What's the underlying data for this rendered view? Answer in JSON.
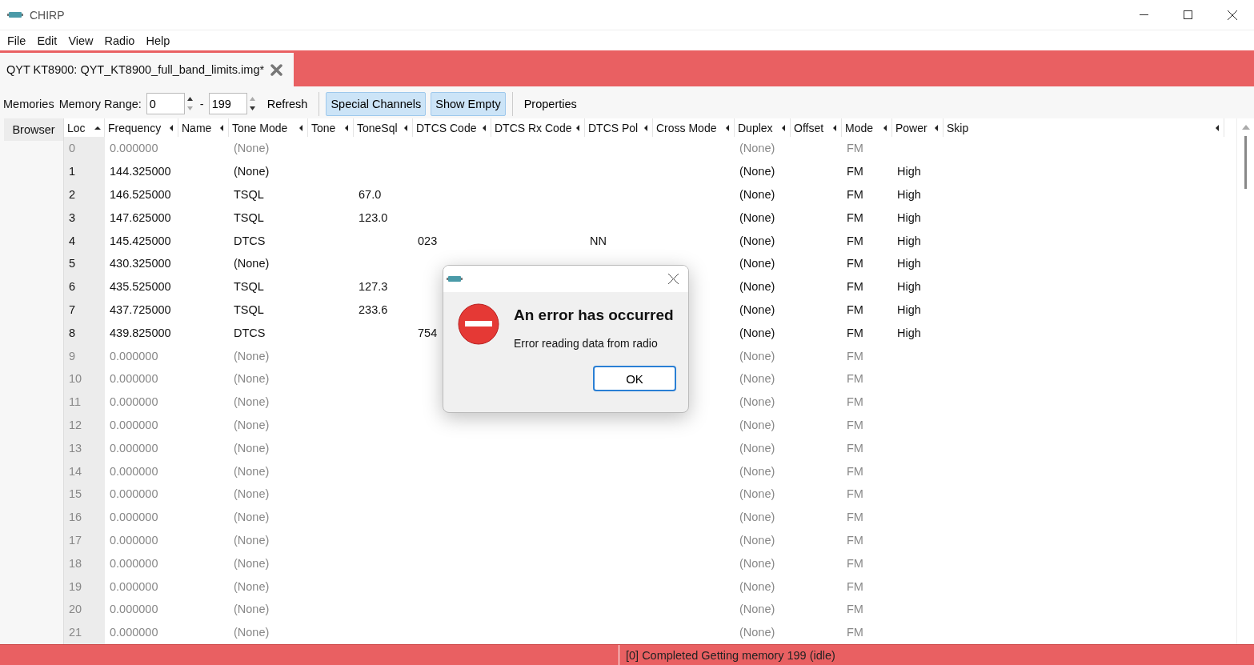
{
  "window": {
    "title": "CHIRP"
  },
  "menu": [
    "File",
    "Edit",
    "View",
    "Radio",
    "Help"
  ],
  "tabs": [
    {
      "label": "QYT KT8900: QYT_KT8900_full_band_limits.img*",
      "selected": true
    }
  ],
  "toolbar": {
    "memories_label": "Memories",
    "range_label": "Memory Range:",
    "range_from": "0",
    "range_sep": "-",
    "range_to": "199",
    "refresh": "Refresh",
    "toggles": [
      {
        "label": "Special Channels",
        "on": true
      },
      {
        "label": "Show Empty",
        "on": true
      }
    ],
    "properties": "Properties"
  },
  "side_tab": "Browser",
  "table": {
    "columns": [
      {
        "label": "Loc",
        "sorted": true
      },
      {
        "label": "Frequency",
        "sorted": false
      },
      {
        "label": "Name",
        "sorted": false
      },
      {
        "label": "Tone Mode",
        "sorted": false
      },
      {
        "label": "Tone",
        "sorted": false
      },
      {
        "label": "ToneSql",
        "sorted": false
      },
      {
        "label": "DTCS Code",
        "sorted": false
      },
      {
        "label": "DTCS Rx Code",
        "sorted": false
      },
      {
        "label": "DTCS Pol",
        "sorted": false
      },
      {
        "label": "Cross Mode",
        "sorted": false
      },
      {
        "label": "Duplex",
        "sorted": false
      },
      {
        "label": "Offset",
        "sorted": false
      },
      {
        "label": "Mode",
        "sorted": false
      },
      {
        "label": "Power",
        "sorted": false
      },
      {
        "label": "Skip",
        "sorted": false
      }
    ],
    "rows": [
      {
        "empty": true,
        "cells": [
          "0",
          "0.000000",
          "",
          "(None)",
          "",
          "",
          "",
          "",
          "",
          "",
          "(None)",
          "",
          "FM",
          "",
          ""
        ]
      },
      {
        "empty": false,
        "cells": [
          "1",
          "144.325000",
          "",
          "(None)",
          "",
          "",
          "",
          "",
          "",
          "",
          "(None)",
          "",
          "FM",
          "High",
          ""
        ]
      },
      {
        "empty": false,
        "cells": [
          "2",
          "146.525000",
          "",
          "TSQL",
          "",
          "67.0",
          "",
          "",
          "",
          "",
          "(None)",
          "",
          "FM",
          "High",
          ""
        ]
      },
      {
        "empty": false,
        "cells": [
          "3",
          "147.625000",
          "",
          "TSQL",
          "",
          "123.0",
          "",
          "",
          "",
          "",
          "(None)",
          "",
          "FM",
          "High",
          ""
        ]
      },
      {
        "empty": false,
        "cells": [
          "4",
          "145.425000",
          "",
          "DTCS",
          "",
          "",
          "023",
          "",
          "NN",
          "",
          "(None)",
          "",
          "FM",
          "High",
          ""
        ]
      },
      {
        "empty": false,
        "cells": [
          "5",
          "430.325000",
          "",
          "(None)",
          "",
          "",
          "",
          "",
          "",
          "",
          "(None)",
          "",
          "FM",
          "High",
          ""
        ]
      },
      {
        "empty": false,
        "cells": [
          "6",
          "435.525000",
          "",
          "TSQL",
          "",
          "127.3",
          "",
          "",
          "",
          "",
          "(None)",
          "",
          "FM",
          "High",
          ""
        ]
      },
      {
        "empty": false,
        "cells": [
          "7",
          "437.725000",
          "",
          "TSQL",
          "",
          "233.6",
          "",
          "",
          "",
          "",
          "(None)",
          "",
          "FM",
          "High",
          ""
        ]
      },
      {
        "empty": false,
        "cells": [
          "8",
          "439.825000",
          "",
          "DTCS",
          "",
          "",
          "754",
          "",
          "",
          "",
          "(None)",
          "",
          "FM",
          "High",
          ""
        ]
      },
      {
        "empty": true,
        "cells": [
          "9",
          "0.000000",
          "",
          "(None)",
          "",
          "",
          "",
          "",
          "",
          "",
          "(None)",
          "",
          "FM",
          "",
          ""
        ]
      },
      {
        "empty": true,
        "cells": [
          "10",
          "0.000000",
          "",
          "(None)",
          "",
          "",
          "",
          "",
          "",
          "",
          "(None)",
          "",
          "FM",
          "",
          ""
        ]
      },
      {
        "empty": true,
        "cells": [
          "11",
          "0.000000",
          "",
          "(None)",
          "",
          "",
          "",
          "",
          "",
          "",
          "(None)",
          "",
          "FM",
          "",
          ""
        ]
      },
      {
        "empty": true,
        "cells": [
          "12",
          "0.000000",
          "",
          "(None)",
          "",
          "",
          "",
          "",
          "",
          "",
          "(None)",
          "",
          "FM",
          "",
          ""
        ]
      },
      {
        "empty": true,
        "cells": [
          "13",
          "0.000000",
          "",
          "(None)",
          "",
          "",
          "",
          "",
          "",
          "",
          "(None)",
          "",
          "FM",
          "",
          ""
        ]
      },
      {
        "empty": true,
        "cells": [
          "14",
          "0.000000",
          "",
          "(None)",
          "",
          "",
          "",
          "",
          "",
          "",
          "(None)",
          "",
          "FM",
          "",
          ""
        ]
      },
      {
        "empty": true,
        "cells": [
          "15",
          "0.000000",
          "",
          "(None)",
          "",
          "",
          "",
          "",
          "",
          "",
          "(None)",
          "",
          "FM",
          "",
          ""
        ]
      },
      {
        "empty": true,
        "cells": [
          "16",
          "0.000000",
          "",
          "(None)",
          "",
          "",
          "",
          "",
          "",
          "",
          "(None)",
          "",
          "FM",
          "",
          ""
        ]
      },
      {
        "empty": true,
        "cells": [
          "17",
          "0.000000",
          "",
          "(None)",
          "",
          "",
          "",
          "",
          "",
          "",
          "(None)",
          "",
          "FM",
          "",
          ""
        ]
      },
      {
        "empty": true,
        "cells": [
          "18",
          "0.000000",
          "",
          "(None)",
          "",
          "",
          "",
          "",
          "",
          "",
          "(None)",
          "",
          "FM",
          "",
          ""
        ]
      },
      {
        "empty": true,
        "cells": [
          "19",
          "0.000000",
          "",
          "(None)",
          "",
          "",
          "",
          "",
          "",
          "",
          "(None)",
          "",
          "FM",
          "",
          ""
        ]
      },
      {
        "empty": true,
        "cells": [
          "20",
          "0.000000",
          "",
          "(None)",
          "",
          "",
          "",
          "",
          "",
          "",
          "(None)",
          "",
          "FM",
          "",
          ""
        ]
      },
      {
        "empty": true,
        "cells": [
          "21",
          "0.000000",
          "",
          "(None)",
          "",
          "",
          "",
          "",
          "",
          "",
          "(None)",
          "",
          "FM",
          "",
          ""
        ]
      }
    ]
  },
  "dialog": {
    "heading": "An error has occurred",
    "message": "Error reading data from radio",
    "button": "OK"
  },
  "status_bar": {
    "message": "[0] Completed Getting memory 199 (idle)"
  }
}
